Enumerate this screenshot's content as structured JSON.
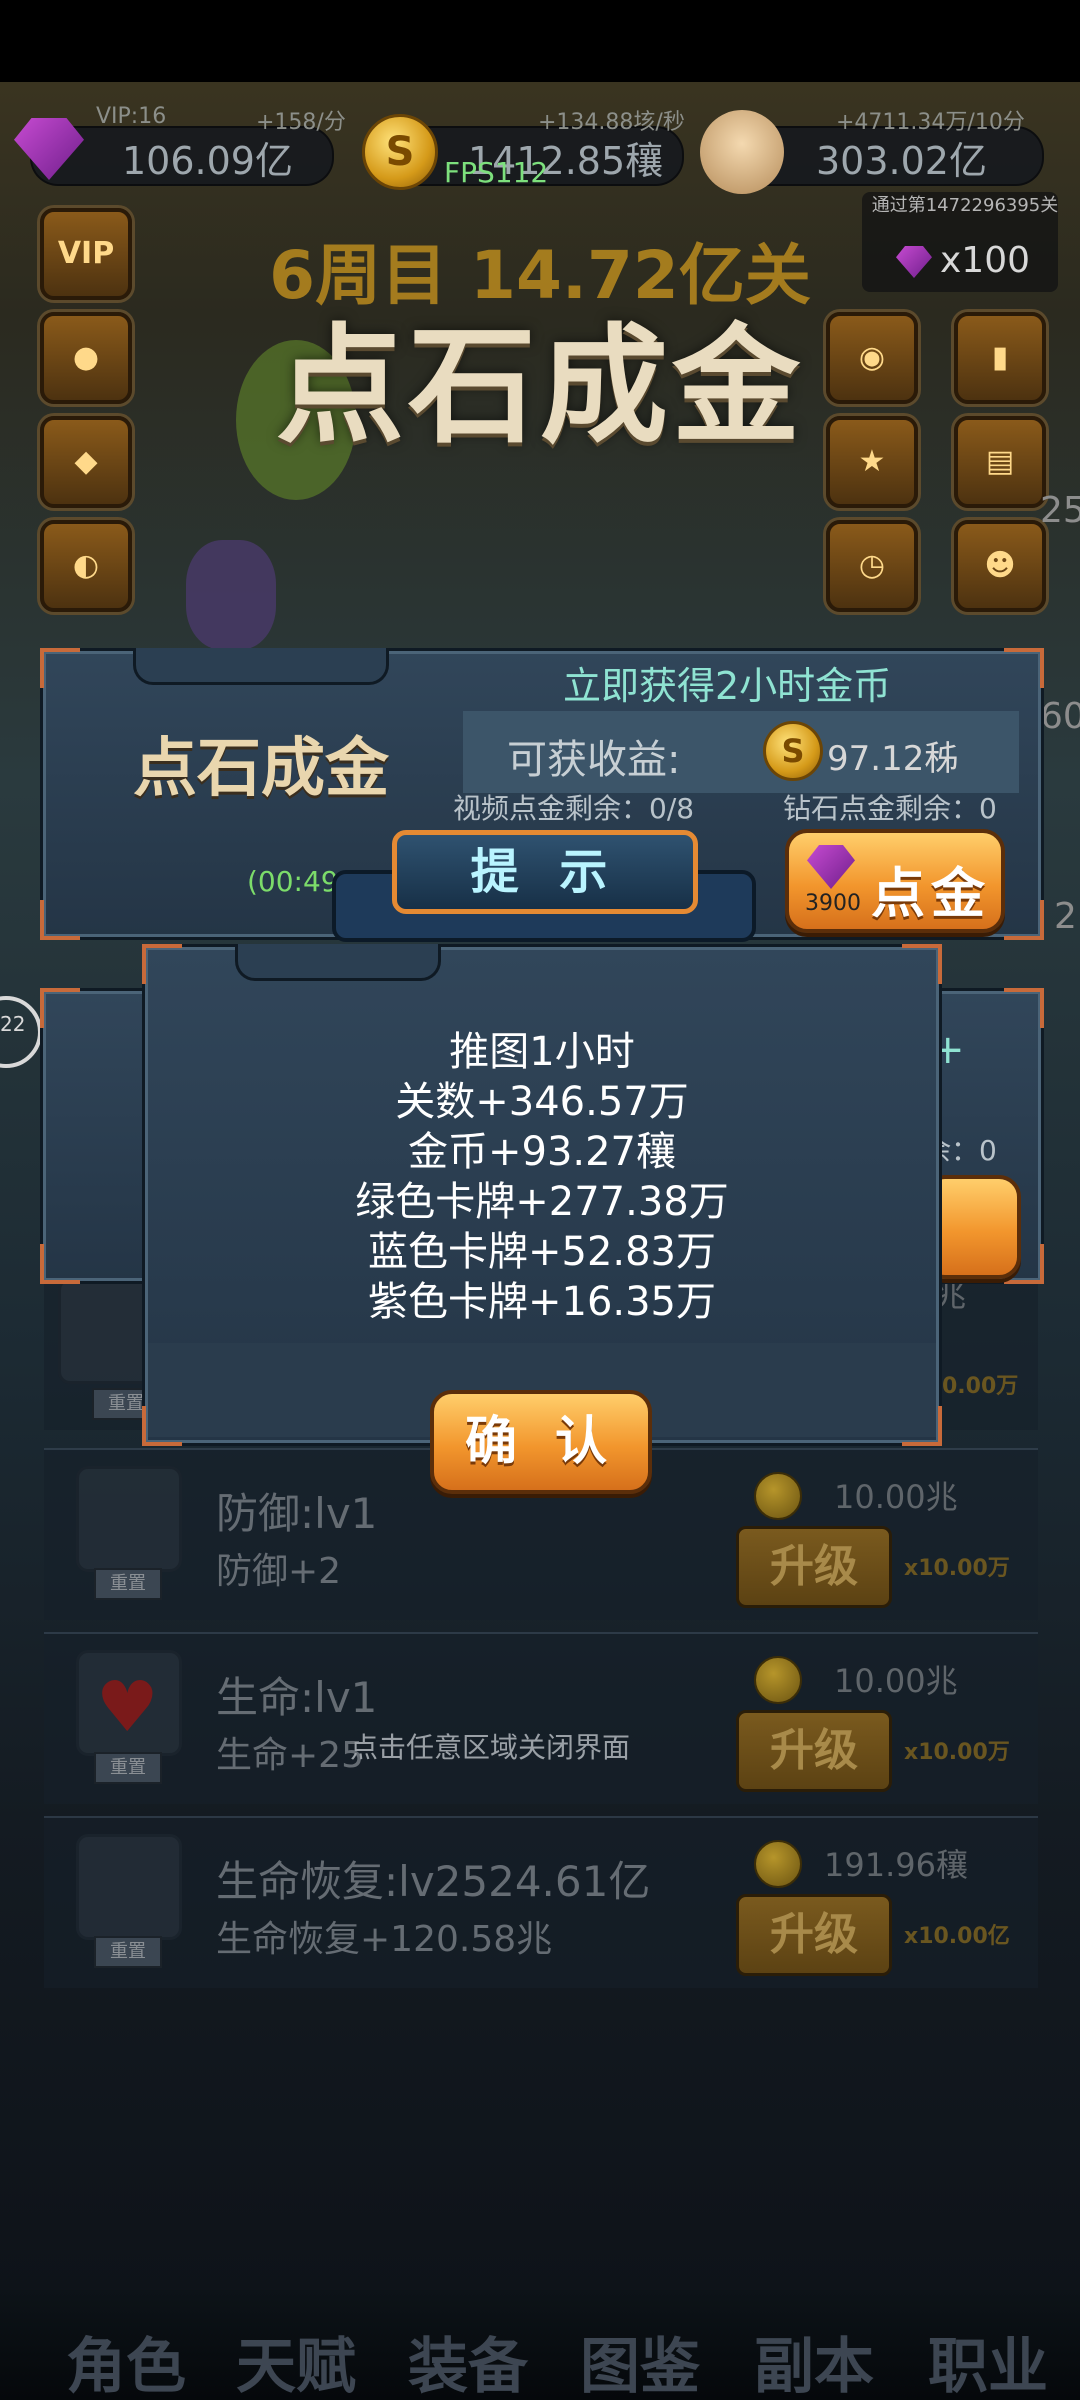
{
  "top_bar": {
    "vip": "VIP:16",
    "gem_rate": "+158/分",
    "gem_value": "106.09亿",
    "coin_rate": "+134.88垓/秒",
    "coin_value": "1412.85穰",
    "skull_rate": "+4711.34万/10分",
    "skull_value": "303.02亿",
    "coin_symbol": "S"
  },
  "fps": "FPS112",
  "stage": "6周目 14.72亿关",
  "pass_reward": {
    "text": "通过第1472296395关",
    "count": "x100"
  },
  "big_title": "点石成金",
  "side_buttons": {
    "vip": "VIP"
  },
  "touch_gold_panel": {
    "title": "点石成金",
    "banner": "立即获得2小时金币",
    "income_label": "可获收益:",
    "income_value": "97.12秭",
    "video_left": "视频点金剩余：0/8",
    "diamond_left": "钻石点金剩余：0",
    "timer": "(00:49",
    "button_label": "点金",
    "button_cost": "3900"
  },
  "behind_panel": {
    "diamond_left_partial": "余：0",
    "plus": "+"
  },
  "modal": {
    "header": "提 示",
    "lines": [
      "推图1小时",
      "关数+346.57万",
      "金币+93.27穰",
      "绿色卡牌+277.38万",
      "蓝色卡牌+52.83万",
      "紫色卡牌+16.35万"
    ],
    "confirm_label": "确 认"
  },
  "close_hint": "点击任意区域关闭界面",
  "upgrade_rows": [
    {
      "name": "防御:lv1",
      "effect": "防御+2",
      "cost": "10.00兆",
      "button": "升级",
      "multiplier": "x10.00万",
      "reset": "重置"
    },
    {
      "name": "生命:lv1",
      "effect": "生命+25",
      "cost": "10.00兆",
      "button": "升级",
      "multiplier": "x10.00万",
      "reset": "重置"
    },
    {
      "name": "生命恢复:lv2524.61亿",
      "effect": "生命恢复+120.58兆",
      "cost": "191.96穰",
      "button": "升级",
      "multiplier": "x10.00亿",
      "reset": "重置"
    }
  ],
  "partial_row": {
    "cost_suffix": "兆",
    "multiplier": "0.00万",
    "reset": "重置"
  },
  "right_edge_numbers": [
    "25",
    "60",
    "2"
  ],
  "left_edge_number": "22",
  "bottom_nav": [
    "角色",
    "天赋",
    "装备",
    "图鉴",
    "副本",
    "职业"
  ],
  "colors": {
    "accent_orange": "#f2962d",
    "panel_blue": "#31465a",
    "text_cream": "#e9d6ae",
    "teal_text": "#8fe3d2"
  }
}
